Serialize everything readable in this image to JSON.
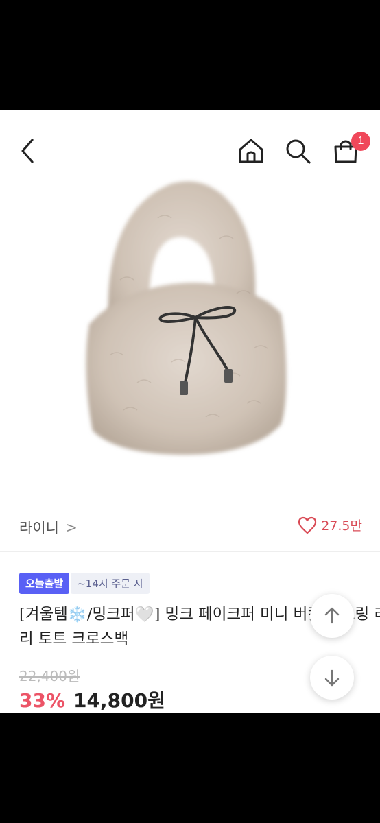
{
  "header": {
    "cart_count": "1"
  },
  "seller": {
    "name": "라이니",
    "chevron": ">"
  },
  "like": {
    "count": "27.5만"
  },
  "tags": {
    "delivery": "오늘출발",
    "cutoff": "~14시 주문 시"
  },
  "product": {
    "title_line1": "[겨울템❄️/밍크퍼🤍] 밍크 페이크퍼 미니 버킷 스트링 리",
    "title_line2": "리 토트 크로스백",
    "original_price": "22,400원",
    "discount": "33%",
    "price": "14,800원"
  },
  "icons": {
    "back": "chevron-left-icon",
    "home": "home-icon",
    "search": "search-icon",
    "cart": "shopping-bag-icon",
    "like": "heart-icon",
    "scroll_up": "arrow-up-icon",
    "scroll_down": "arrow-down-icon"
  },
  "colors": {
    "badge": "#f0485a",
    "delivery_tag": "#5960f5",
    "discount": "#ec5467",
    "like": "#d94a55"
  }
}
